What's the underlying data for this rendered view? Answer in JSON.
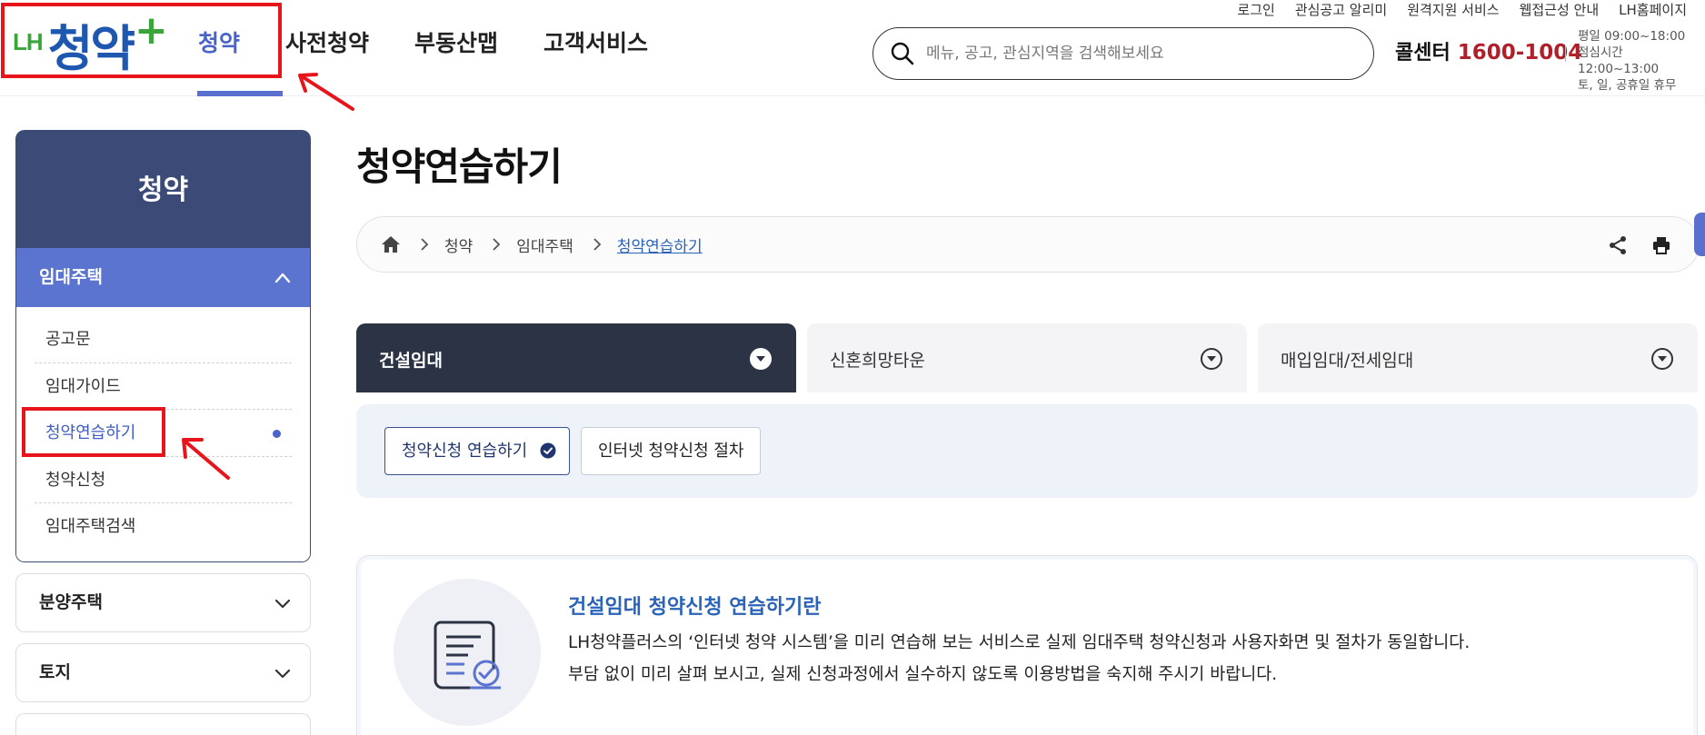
{
  "header": {
    "logo": {
      "prefix": "LH",
      "main": "청약",
      "suffix": "+"
    },
    "gnb": [
      {
        "label": "청약",
        "active": true
      },
      {
        "label": "사전청약",
        "active": false
      },
      {
        "label": "부동산맵",
        "active": false
      },
      {
        "label": "고객서비스",
        "active": false
      }
    ],
    "util_links": [
      "로그인",
      "관심공고 알리미",
      "원격지원 서비스",
      "웹접근성 안내",
      "LH홈페이지"
    ],
    "search": {
      "placeholder": "메뉴, 공고, 관심지역을 검색해보세요"
    },
    "callcenter": {
      "label": "콜센터",
      "number": "1600-1004",
      "hours": [
        "평일 09:00~18:00",
        "점심시간 12:00~13:00",
        "토, 일, 공휴일 휴무"
      ]
    }
  },
  "sidebar": {
    "title": "청약",
    "open_section": {
      "label": "임대주택",
      "items": [
        {
          "label": "공고문",
          "active": false
        },
        {
          "label": "임대가이드",
          "active": false
        },
        {
          "label": "청약연습하기",
          "active": true
        },
        {
          "label": "청약신청",
          "active": false
        },
        {
          "label": "임대주택검색",
          "active": false
        }
      ]
    },
    "closed_sections": [
      "분양주택",
      "토지"
    ]
  },
  "main": {
    "title": "청약연습하기",
    "breadcrumb": [
      "청약",
      "임대주택",
      "청약연습하기"
    ],
    "tabs": [
      {
        "label": "건설임대",
        "active": true
      },
      {
        "label": "신혼희망타운",
        "active": false
      },
      {
        "label": "매입임대/전세임대",
        "active": false
      }
    ],
    "subtabs": [
      {
        "label": "청약신청 연습하기",
        "active": true
      },
      {
        "label": "인터넷 청약신청 절차",
        "active": false
      }
    ],
    "intro": {
      "title": "건설임대 청약신청 연습하기란",
      "lines": [
        "LH청약플러스의 ‘인터넷 청약 시스템’을 미리 연습해 보는 서비스로 실제 임대주택 청약신청과 사용자화면 및 절차가 동일합니다.",
        "부담 없이 미리 살펴 보시고, 실제 신청과정에서 실수하지 않도록 이용방법을 숙지해 주시기 바랍니다."
      ]
    }
  },
  "colors": {
    "accent": "#4a63c9",
    "sidebar_head": "#3b4a77",
    "active_tab": "#2c3344",
    "callcenter_number": "#b0202a",
    "annotation": "#e8141b"
  },
  "icons": [
    "search-icon",
    "home-icon",
    "chevron-right-icon",
    "chevron-up-icon",
    "chevron-down-icon",
    "share-icon",
    "print-icon",
    "dropdown-circle-icon",
    "check-circle-icon",
    "document-icon"
  ]
}
